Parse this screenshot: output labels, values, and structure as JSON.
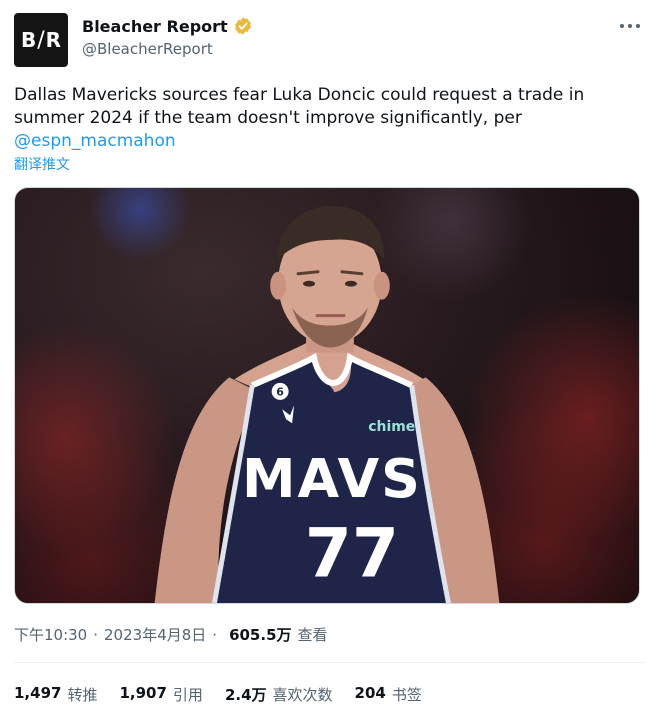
{
  "account": {
    "avatar_text_left": "B",
    "avatar_text_slash": "/",
    "avatar_text_right": "R",
    "display_name": "Bleacher Report",
    "handle": "@BleacherReport",
    "verified_color": "#e8b93a"
  },
  "tweet": {
    "line1": "Dallas Mavericks sources fear Luka Doncic could request a trade in",
    "line2": "summer 2024 if the team doesn't improve significantly, per",
    "mention": "@espn_macmahon",
    "translate_label": "翻译推文"
  },
  "photo": {
    "jersey_text": "MAVS",
    "jersey_number": "77",
    "patch_number": "6",
    "sponsor": "chime"
  },
  "meta": {
    "time": "下午10:30",
    "separator": "·",
    "date": "2023年4月8日",
    "views": "605.5万",
    "views_label": "查看"
  },
  "stats": [
    {
      "num": "1,497",
      "label": "转推"
    },
    {
      "num": "1,907",
      "label": "引用"
    },
    {
      "num": "2.4万",
      "label": "喜欢次数"
    },
    {
      "num": "204",
      "label": "书签"
    }
  ],
  "colors": {
    "link": "#1d9bf0",
    "secondary_text": "#536471",
    "jersey": "#1f2549"
  }
}
